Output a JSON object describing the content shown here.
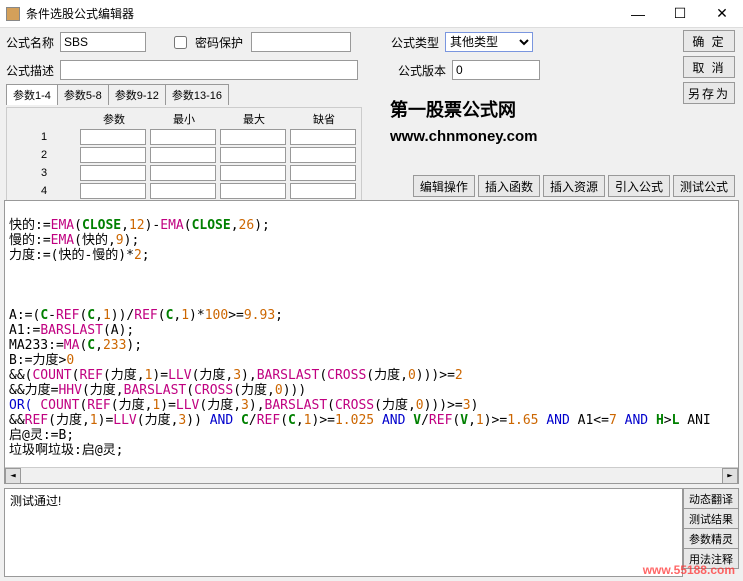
{
  "title": "条件选股公式编辑器",
  "winbtns": {
    "min": "—",
    "max": "☐",
    "close": "✕"
  },
  "labels": {
    "name": "公式名称",
    "pwdprotect": "密码保护",
    "type": "公式类型",
    "desc": "公式描述",
    "version": "公式版本"
  },
  "fields": {
    "name": "SBS",
    "desc": "",
    "type": "其他类型",
    "version": "0",
    "pwd": ""
  },
  "buttons": {
    "ok": "确  定",
    "cancel": "取  消",
    "saveas": "另存为",
    "editop": "编辑操作",
    "insfunc": "插入函数",
    "insres": "插入资源",
    "import": "引入公式",
    "test": "测试公式"
  },
  "tabs": [
    "参数1-4",
    "参数5-8",
    "参数9-12",
    "参数13-16"
  ],
  "paramheaders": [
    "参数",
    "最小",
    "最大",
    "缺省"
  ],
  "paramrows": [
    "1",
    "2",
    "3",
    "4"
  ],
  "watermark": {
    "l1": "第一股票公式网",
    "l2": "www.chnmoney.com"
  },
  "code": {
    "l1a": "快的:=",
    "l1b": "EMA",
    "l1c": "(",
    "l1d": "CLOSE",
    "l1e": ",",
    "l1f": "12",
    "l1g": ")-",
    "l1h": "EMA",
    "l1i": "(",
    "l1j": "CLOSE",
    "l1k": ",",
    "l1l": "26",
    "l1m": ");",
    "l2a": "慢的:=",
    "l2b": "EMA",
    "l2c": "(快的,",
    "l2d": "9",
    "l2e": ");",
    "l3a": "力度:=(快的-慢的)*",
    "l3b": "2",
    "l3c": ";",
    "l4a": "A:=(",
    "l4b": "C",
    "l4c": "-",
    "l4d": "REF",
    "l4e": "(",
    "l4f": "C",
    "l4g": ",",
    "l4h": "1",
    "l4i": "))/",
    "l4j": "REF",
    "l4k": "(",
    "l4l": "C",
    "l4m": ",",
    "l4n": "1",
    "l4o": ")*",
    "l4p": "100",
    "l4q": ">=",
    "l4r": "9.93",
    "l4s": ";",
    "l5a": "A1:=",
    "l5b": "BARSLAST",
    "l5c": "(A);",
    "l6a": "MA233:=",
    "l6b": "MA",
    "l6c": "(",
    "l6d": "C",
    "l6e": ",",
    "l6f": "233",
    "l6g": ");",
    "l7a": "B:=力度>",
    "l7b": "0",
    "l8a": "&&(",
    "l8b": "COUNT",
    "l8c": "(",
    "l8d": "REF",
    "l8e": "(力度,",
    "l8f": "1",
    "l8g": ")=",
    "l8h": "LLV",
    "l8i": "(力度,",
    "l8j": "3",
    "l8k": "),",
    "l8l": "BARSLAST",
    "l8m": "(",
    "l8n": "CROSS",
    "l8o": "(力度,",
    "l8p": "0",
    "l8q": ")))>=",
    "l8r": "2",
    "l9a": "&&力度=",
    "l9b": "HHV",
    "l9c": "(力度,",
    "l9d": "BARSLAST",
    "l9e": "(",
    "l9f": "CROSS",
    "l9g": "(力度,",
    "l9h": "0",
    "l9i": ")))",
    "l10a": "OR( ",
    "l10b": "COUNT",
    "l10c": "(",
    "l10d": "REF",
    "l10e": "(力度,",
    "l10f": "1",
    "l10g": ")=",
    "l10h": "LLV",
    "l10i": "(力度,",
    "l10j": "3",
    "l10k": "),",
    "l10l": "BARSLAST",
    "l10m": "(",
    "l10n": "CROSS",
    "l10o": "(力度,",
    "l10p": "0",
    "l10q": ")))>=",
    "l10r": "3",
    "l10s": ")",
    "l11a": "&&",
    "l11b": "REF",
    "l11c": "(力度,",
    "l11d": "1",
    "l11e": ")=",
    "l11f": "LLV",
    "l11g": "(力度,",
    "l11h": "3",
    "l11i": ")) ",
    "l11j": "AND",
    "l11k": " ",
    "l11l": "C",
    "l11m": "/",
    "l11n": "REF",
    "l11o": "(",
    "l11p": "C",
    "l11q": ",",
    "l11r": "1",
    "l11s": ")>=",
    "l11t": "1.025",
    "l11u": " ",
    "l11v": "AND",
    "l11w": " ",
    "l11x": "V",
    "l11y": "/",
    "l11z": "REF",
    "l11aa": "(",
    "l11ab": "V",
    "l11ac": ",",
    "l11ad": "1",
    "l11ae": ")>=",
    "l11af": "1.65",
    "l11ag": " ",
    "l11ah": "AND",
    "l11ai": " A1<=",
    "l11aj": "7",
    "l11ak": " ",
    "l11al": "AND",
    "l11am": " ",
    "l11an": "H",
    "l11ao": ">",
    "l11ap": "L",
    "l11aq": " ANI",
    "l12": "启@灵:=B;",
    "l13": "垃圾啊垃圾:启@灵;"
  },
  "testmsg": "测试通过!",
  "sidebtns": [
    "动态翻译",
    "测试结果",
    "参数精灵",
    "用法注释"
  ],
  "footerlink": "www.55188.com"
}
